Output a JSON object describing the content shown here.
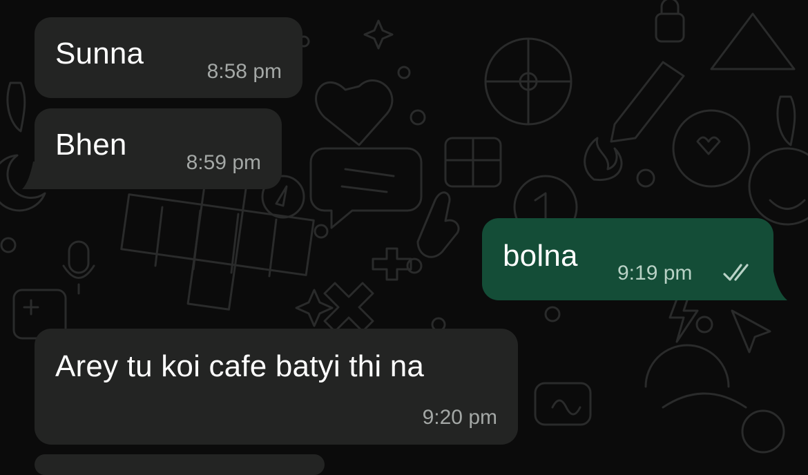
{
  "theme": {
    "background": "#0b0b0b",
    "incoming_bubble": "#232423",
    "outgoing_bubble": "#144d37",
    "text": "#ffffff",
    "timestamp": "#a4a8a6",
    "read_ticks": "#b9d2c6"
  },
  "messages": [
    {
      "direction": "incoming",
      "text": "Sunna",
      "time": "8:58 pm"
    },
    {
      "direction": "incoming",
      "text": "Bhen",
      "time": "8:59 pm"
    },
    {
      "direction": "outgoing",
      "text": "bolna",
      "time": "9:19 pm",
      "status_icon": "double-check-icon"
    },
    {
      "direction": "incoming",
      "text": "Arey tu koi cafe batyi thi na",
      "time": "9:20 pm"
    }
  ]
}
